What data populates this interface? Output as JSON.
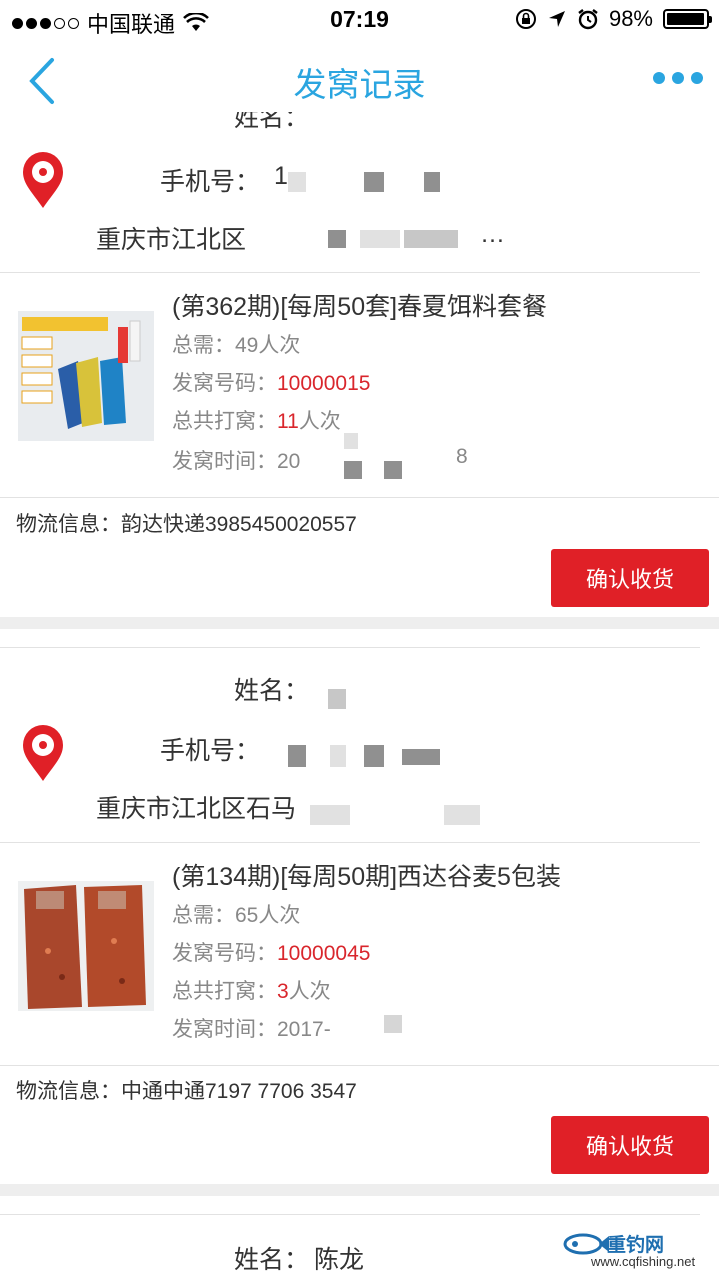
{
  "status_bar": {
    "carrier": "中国联通",
    "time": "07:19",
    "battery": "98%",
    "battery_level": 0.98
  },
  "nav": {
    "title": "发窝记录"
  },
  "labels": {
    "name": "姓名：",
    "phone": "手机号：",
    "total_need": "总需：",
    "nest_no": "发窝号码：",
    "total_nests": "总共打窝：",
    "nest_time": "发窝时间：",
    "logistics": "物流信息：",
    "confirm": "确认收货"
  },
  "records": [
    {
      "name_partial": "姓名：",
      "phone_partial": "1",
      "address": "重庆市江北区",
      "address_tail": "…",
      "product_title": "(第362期)[每周50套]春夏饵料套餐",
      "total_need": "49人次",
      "nest_no": "10000015",
      "total_nests_value": "11",
      "total_nests_suffix": "人次",
      "nest_time_start": "20",
      "nest_time_end": "8",
      "logistics_value": "韵达快递3985450020557"
    },
    {
      "name": "",
      "phone": "",
      "address": "重庆市江北区石马",
      "product_title": "(第134期)[每周50期]西达谷麦5包装",
      "total_need": "65人次",
      "nest_no": "10000045",
      "total_nests_value": "3",
      "total_nests_suffix": "人次",
      "nest_time_start": "2017-",
      "logistics_value": "中通中通7197 7706 3547"
    },
    {
      "name": "陈龙"
    }
  ],
  "watermark": {
    "brand": "重钓网",
    "url": "www.cqfishing.net"
  },
  "colors": {
    "accent": "#2aa5e0",
    "red": "#e02027"
  }
}
